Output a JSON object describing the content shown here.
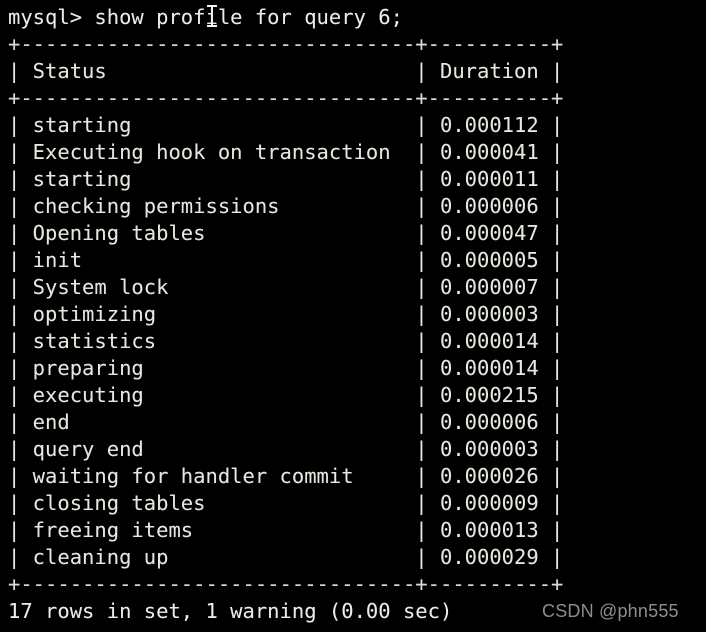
{
  "terminal": {
    "prompt_line": "mysql> show profile for query 6;",
    "separator": "+--------------------------------+----------+",
    "header_row": "| Status                         | Duration |",
    "footer_status": "17 rows in set, 1 warning (0.00 sec)",
    "watermark": "CSDN @phn555",
    "colors": {
      "background": "#000000",
      "text": "#e8e6df",
      "watermark": "#8e8e8e"
    },
    "columns": {
      "status_header": "Status",
      "duration_header": "Duration",
      "status_width": 32,
      "duration_width": 10
    },
    "rows": [
      {
        "status": "starting",
        "duration": "0.000112",
        "line": "| starting                       | 0.000112 |"
      },
      {
        "status": "Executing hook on transaction",
        "duration": "0.000041",
        "line": "| Executing hook on transaction  | 0.000041 |"
      },
      {
        "status": "starting",
        "duration": "0.000011",
        "line": "| starting                       | 0.000011 |"
      },
      {
        "status": "checking permissions",
        "duration": "0.000006",
        "line": "| checking permissions           | 0.000006 |"
      },
      {
        "status": "Opening tables",
        "duration": "0.000047",
        "line": "| Opening tables                 | 0.000047 |"
      },
      {
        "status": "init",
        "duration": "0.000005",
        "line": "| init                           | 0.000005 |"
      },
      {
        "status": "System lock",
        "duration": "0.000007",
        "line": "| System lock                    | 0.000007 |"
      },
      {
        "status": "optimizing",
        "duration": "0.000003",
        "line": "| optimizing                     | 0.000003 |"
      },
      {
        "status": "statistics",
        "duration": "0.000014",
        "line": "| statistics                     | 0.000014 |"
      },
      {
        "status": "preparing",
        "duration": "0.000014",
        "line": "| preparing                      | 0.000014 |"
      },
      {
        "status": "executing",
        "duration": "0.000215",
        "line": "| executing                      | 0.000215 |"
      },
      {
        "status": "end",
        "duration": "0.000006",
        "line": "| end                            | 0.000006 |"
      },
      {
        "status": "query end",
        "duration": "0.000003",
        "line": "| query end                      | 0.000003 |"
      },
      {
        "status": "waiting for handler commit",
        "duration": "0.000026",
        "line": "| waiting for handler commit     | 0.000026 |"
      },
      {
        "status": "closing tables",
        "duration": "0.000009",
        "line": "| closing tables                 | 0.000009 |"
      },
      {
        "status": "freeing items",
        "duration": "0.000013",
        "line": "| freeing items                  | 0.000013 |"
      },
      {
        "status": "cleaning up",
        "duration": "0.000029",
        "line": "| cleaning up                    | 0.000029 |"
      }
    ]
  }
}
